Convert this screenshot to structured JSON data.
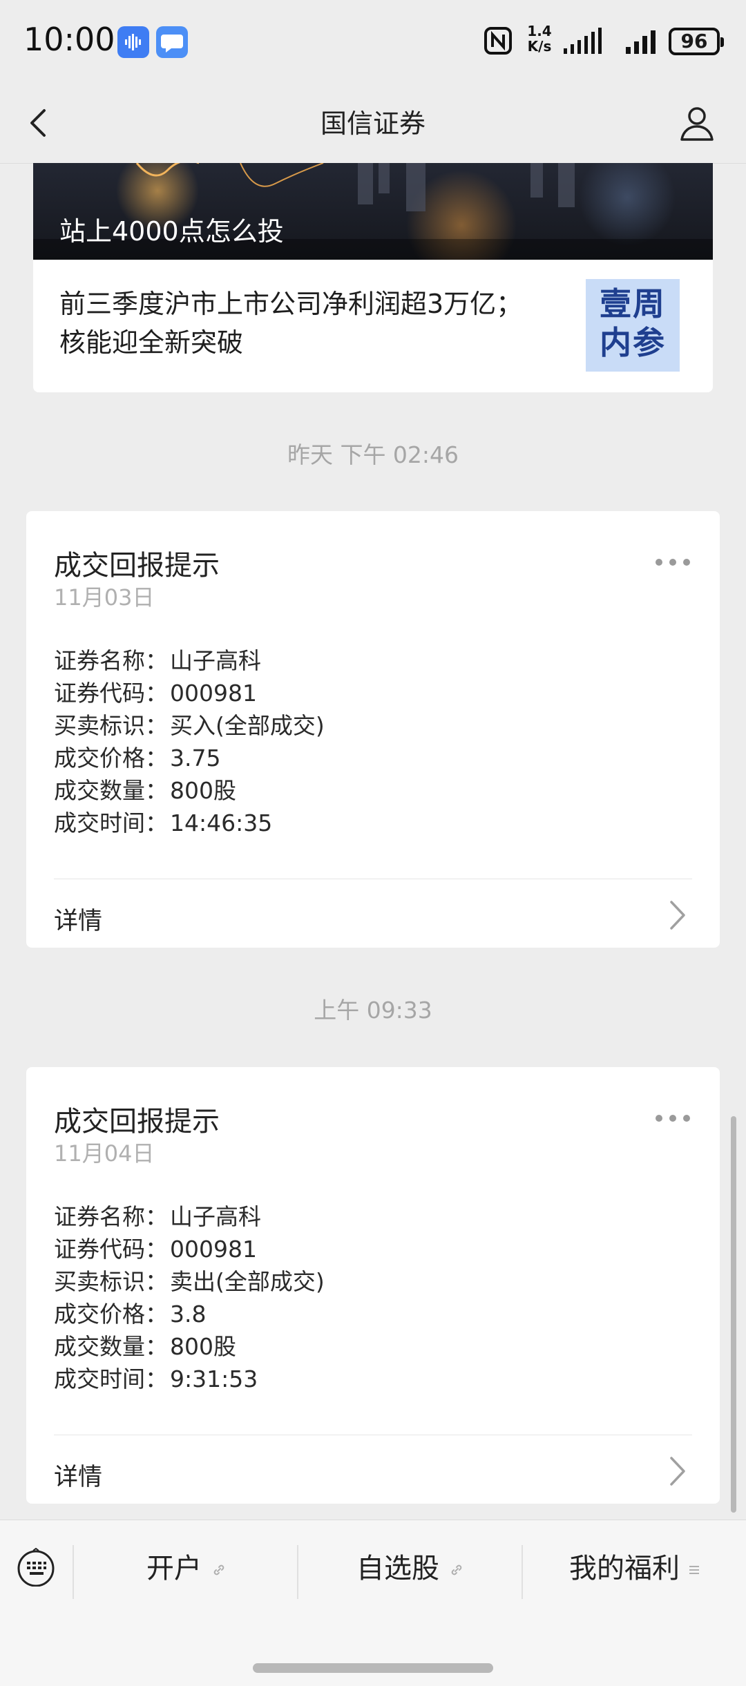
{
  "status_bar": {
    "time": "10:00",
    "network_speed_value": "1.4",
    "network_speed_unit": "K/s",
    "battery": "96",
    "icons": [
      "app-voice-badge",
      "app-chat-badge",
      "nfc-icon",
      "signal-icon",
      "signal-icon",
      "battery-icon"
    ]
  },
  "nav": {
    "title": "国信证券",
    "icons": {
      "back": "chevron-left-icon",
      "profile": "person-icon"
    }
  },
  "article": {
    "banner_title": "站上4000点怎么投",
    "summary_line1": "前三季度沪市上市公司净利润超3万亿；",
    "summary_line2": "核能迎全新突破",
    "thumb_line1": "壹周",
    "thumb_line2": "内参"
  },
  "dividers": [
    "昨天 下午 02:46",
    "上午 09:33"
  ],
  "trades": [
    {
      "title": "成交回报提示",
      "date": "11月03日",
      "fields": [
        {
          "label": "证券名称：",
          "value": "山子高科"
        },
        {
          "label": "证券代码：",
          "value": "000981"
        },
        {
          "label": "买卖标识：",
          "value": "买入(全部成交)"
        },
        {
          "label": "成交价格：",
          "value": "3.75"
        },
        {
          "label": "成交数量：",
          "value": "800股"
        },
        {
          "label": "成交时间：",
          "value": "14:46:35"
        }
      ],
      "detail": "详情"
    },
    {
      "title": "成交回报提示",
      "date": "11月04日",
      "fields": [
        {
          "label": "证券名称：",
          "value": "山子高科"
        },
        {
          "label": "证券代码：",
          "value": "000981"
        },
        {
          "label": "买卖标识：",
          "value": "卖出(全部成交)"
        },
        {
          "label": "成交价格：",
          "value": "3.8"
        },
        {
          "label": "成交数量：",
          "value": "800股"
        },
        {
          "label": "成交时间：",
          "value": "9:31:53"
        }
      ],
      "detail": "详情"
    }
  ],
  "bottom_menu": {
    "items": [
      "开户",
      "自选股",
      "我的福利"
    ],
    "icons": {
      "keyboard": "keyboard-icon",
      "link": "link-icon",
      "submenu": "list-icon"
    }
  },
  "colors": {
    "background": "#ededed",
    "card": "#ffffff",
    "muted_text": "#a6a6a6",
    "thumb_bg": "#c9dcf7",
    "thumb_text": "#1f3f8f"
  }
}
